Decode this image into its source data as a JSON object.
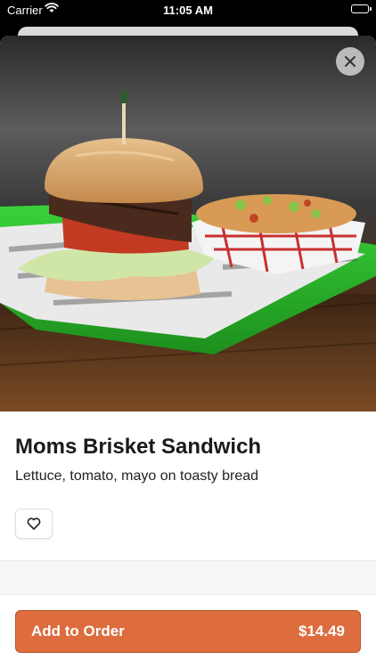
{
  "status_bar": {
    "carrier": "Carrier",
    "time": "11:05 AM",
    "wifi_icon": "wifi-icon",
    "battery_icon": "battery-icon"
  },
  "item": {
    "image_alt_icon": "food-photo",
    "name": "Moms Brisket Sandwich",
    "description": "Lettuce, tomato, mayo on toasty bread",
    "favorite_icon": "heart-icon"
  },
  "close_icon": "close-icon",
  "order_button": {
    "label": "Add to Order",
    "price": "$14.49"
  },
  "colors": {
    "accent": "#dd6c3f",
    "accent_border": "#b5552a",
    "tray": "#2fc02f"
  }
}
